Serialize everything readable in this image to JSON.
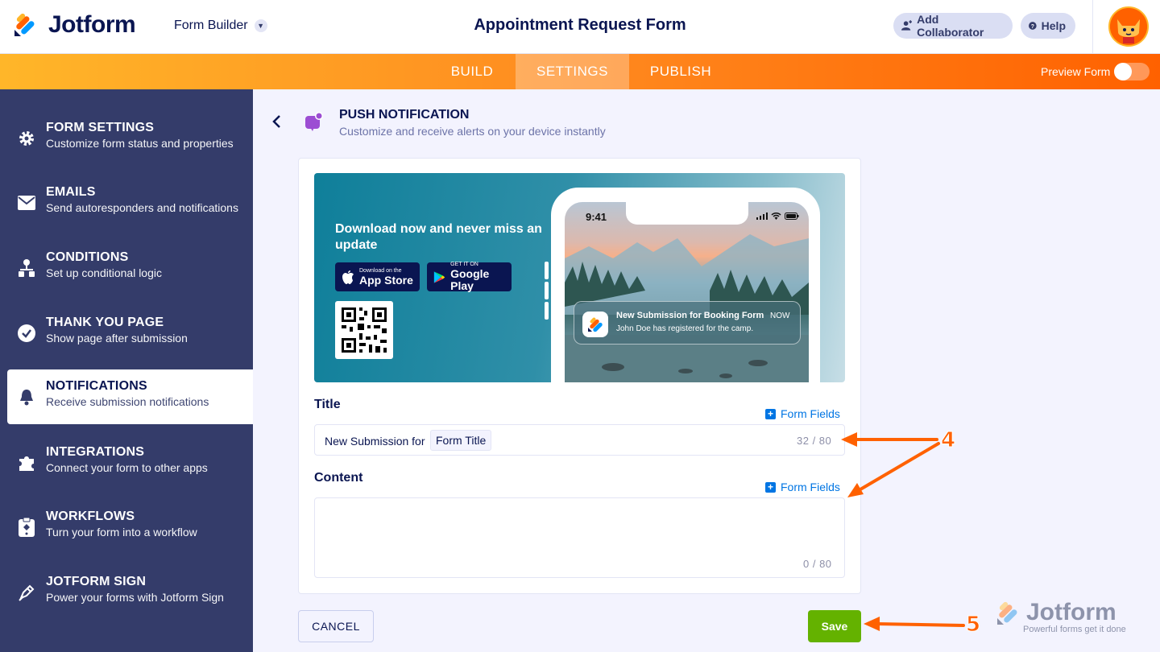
{
  "header": {
    "brand": "Jotform",
    "builder_label": "Form Builder",
    "form_title": "Appointment Request Form",
    "add_collaborator": "Add Collaborator",
    "help": "Help"
  },
  "nav": {
    "tabs": [
      {
        "label": "BUILD"
      },
      {
        "label": "SETTINGS"
      },
      {
        "label": "PUBLISH"
      }
    ],
    "active_tab": "SETTINGS",
    "preview_label": "Preview Form",
    "preview_enabled": false
  },
  "sidebar": {
    "items": [
      {
        "title": "FORM SETTINGS",
        "subtitle": "Customize form status and properties",
        "icon": "gear-icon"
      },
      {
        "title": "EMAILS",
        "subtitle": "Send autoresponders and notifications",
        "icon": "envelope-icon"
      },
      {
        "title": "CONDITIONS",
        "subtitle": "Set up conditional logic",
        "icon": "hierarchy-icon"
      },
      {
        "title": "THANK YOU PAGE",
        "subtitle": "Show page after submission",
        "icon": "check-circle-icon"
      },
      {
        "title": "NOTIFICATIONS",
        "subtitle": "Receive submission notifications",
        "icon": "bell-icon"
      },
      {
        "title": "INTEGRATIONS",
        "subtitle": "Connect your form to other apps",
        "icon": "puzzle-icon"
      },
      {
        "title": "WORKFLOWS",
        "subtitle": "Turn your form into a workflow",
        "icon": "workflow-icon"
      },
      {
        "title": "JOTFORM SIGN",
        "subtitle": "Power your forms with Jotform Sign",
        "icon": "pen-icon"
      }
    ],
    "active_index": 4
  },
  "panel": {
    "title": "PUSH NOTIFICATION",
    "subtitle": "Customize and receive alerts on your device instantly"
  },
  "banner": {
    "headline": "Download now and never miss an update",
    "app_store_small": "Download on the",
    "app_store_big": "App Store",
    "google_small": "GET IT ON",
    "google_big": "Google Play",
    "phone_time": "9:41",
    "notification_title": "New Submission for Booking Form",
    "notification_body": "John Doe has registered for the camp.",
    "notification_time": "NOW"
  },
  "form": {
    "title_label": "Title",
    "title_prefix": "New Submission for",
    "title_tag": "Form Title",
    "title_counter": "32 / 80",
    "content_label": "Content",
    "content_value": "",
    "content_counter": "0 / 80",
    "form_fields_link": "Form Fields"
  },
  "actions": {
    "cancel": "CANCEL",
    "save": "Save"
  },
  "annotations": {
    "step4": "4",
    "step5": "5"
  },
  "watermark": {
    "brand": "Jotform",
    "tagline": "Powerful forms get it done"
  },
  "colors": {
    "accent_orange": "#ff6100",
    "navy": "#0a1551",
    "sidebar": "#343c6a",
    "save_green": "#64b200",
    "link_blue": "#0075e3"
  }
}
